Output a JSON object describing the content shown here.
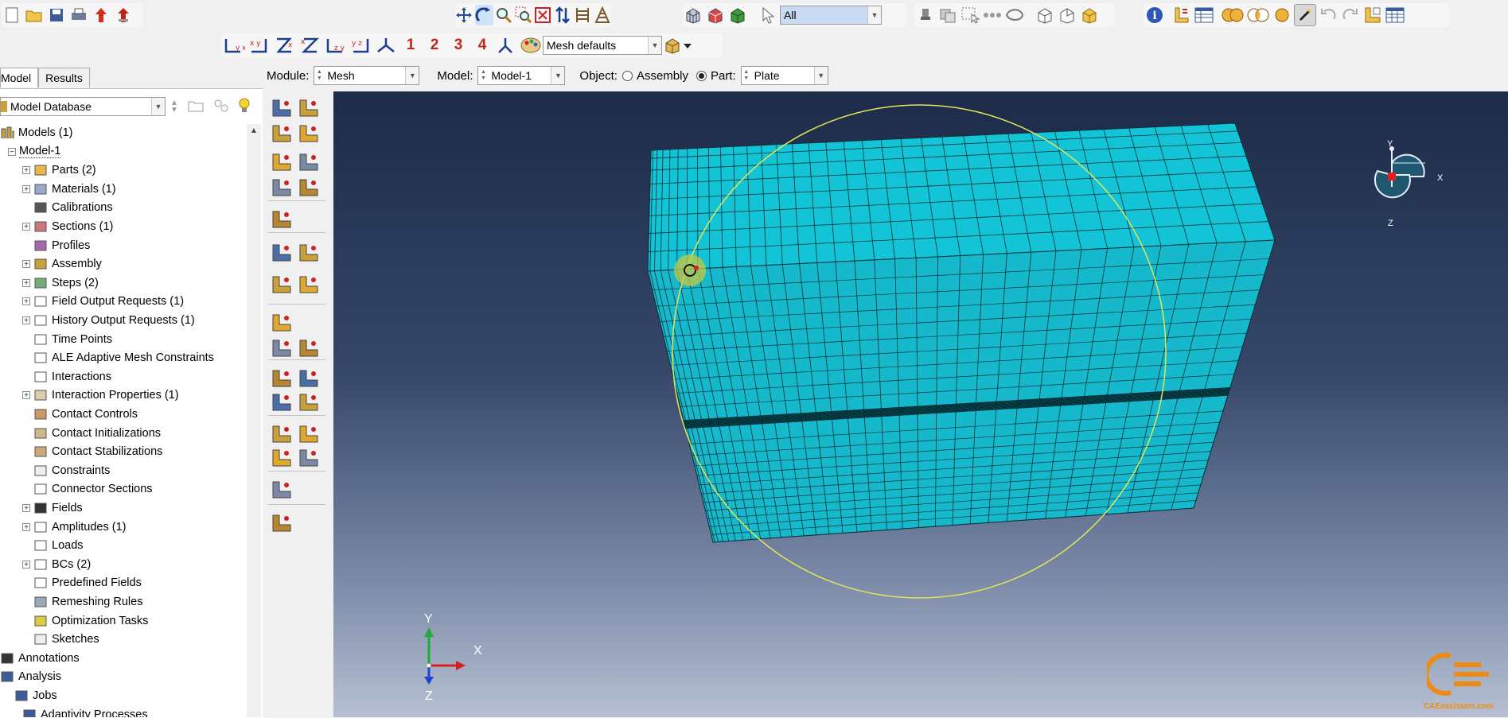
{
  "toolbar": {
    "view_numbers": [
      "1",
      "2",
      "3",
      "4"
    ],
    "selection_filter": {
      "value": "All"
    },
    "render_style": {
      "value": "Mesh defaults"
    }
  },
  "context": {
    "module_label": "Module:",
    "module_value": "Mesh",
    "model_label": "Model:",
    "model_value": "Model-1",
    "object_label": "Object:",
    "assembly_label": "Assembly",
    "part_label": "Part:",
    "part_value": "Plate",
    "object_selected": "part"
  },
  "left_panel": {
    "tabs": [
      {
        "label": "Model",
        "active": true
      },
      {
        "label": "Results",
        "active": false
      }
    ],
    "database_select": "Model Database"
  },
  "tree": {
    "root": "Models (1)",
    "model": "Model-1",
    "items": [
      {
        "label": "Parts (2)",
        "expandable": true,
        "icon": "parts-icon"
      },
      {
        "label": "Materials (1)",
        "expandable": true,
        "icon": "materials-icon"
      },
      {
        "label": "Calibrations",
        "expandable": false,
        "icon": "calibrations-icon"
      },
      {
        "label": "Sections (1)",
        "expandable": true,
        "icon": "sections-icon"
      },
      {
        "label": "Profiles",
        "expandable": false,
        "icon": "profiles-icon"
      },
      {
        "label": "Assembly",
        "expandable": true,
        "icon": "assembly-icon"
      },
      {
        "label": "Steps (2)",
        "expandable": true,
        "icon": "steps-icon"
      },
      {
        "label": "Field Output Requests (1)",
        "expandable": true,
        "icon": "field-output-icon"
      },
      {
        "label": "History Output Requests (1)",
        "expandable": true,
        "icon": "history-output-icon"
      },
      {
        "label": "Time Points",
        "expandable": false,
        "icon": "time-points-icon"
      },
      {
        "label": "ALE Adaptive Mesh Constraints",
        "expandable": false,
        "icon": "ale-icon"
      },
      {
        "label": "Interactions",
        "expandable": false,
        "icon": "interactions-icon"
      },
      {
        "label": "Interaction Properties (1)",
        "expandable": true,
        "icon": "interaction-properties-icon"
      },
      {
        "label": "Contact Controls",
        "expandable": false,
        "icon": "contact-controls-icon"
      },
      {
        "label": "Contact Initializations",
        "expandable": false,
        "icon": "contact-initializations-icon"
      },
      {
        "label": "Contact Stabilizations",
        "expandable": false,
        "icon": "contact-stabilizations-icon"
      },
      {
        "label": "Constraints",
        "expandable": false,
        "icon": "constraints-icon"
      },
      {
        "label": "Connector Sections",
        "expandable": false,
        "icon": "connector-sections-icon"
      },
      {
        "label": "Fields",
        "expandable": true,
        "icon": "fields-icon"
      },
      {
        "label": "Amplitudes (1)",
        "expandable": true,
        "icon": "amplitudes-icon"
      },
      {
        "label": "Loads",
        "expandable": false,
        "icon": "loads-icon"
      },
      {
        "label": "BCs (2)",
        "expandable": true,
        "icon": "bcs-icon"
      },
      {
        "label": "Predefined Fields",
        "expandable": false,
        "icon": "predefined-fields-icon"
      },
      {
        "label": "Remeshing Rules",
        "expandable": false,
        "icon": "remeshing-rules-icon"
      },
      {
        "label": "Optimization Tasks",
        "expandable": false,
        "icon": "optimization-tasks-icon"
      },
      {
        "label": "Sketches",
        "expandable": false,
        "icon": "sketches-icon"
      }
    ],
    "bottom": [
      {
        "label": "Annotations",
        "icon": "annotations-icon"
      },
      {
        "label": "Analysis",
        "icon": "analysis-icon"
      },
      {
        "label": "Jobs",
        "icon": "jobs-icon"
      },
      {
        "label": "Adaptivity Processes",
        "icon": "adaptivity-icon"
      }
    ]
  },
  "viewport": {
    "triad": {
      "x": "X",
      "y": "Y",
      "z": "Z"
    },
    "compass": {
      "x": "X",
      "y": "Y",
      "z": "Z"
    },
    "watermark": "CAEassistant.com",
    "colors": {
      "mesh_fill": "#12c4d6",
      "mesh_line": "#053038",
      "rotation_circle": "#e2e45a"
    }
  }
}
